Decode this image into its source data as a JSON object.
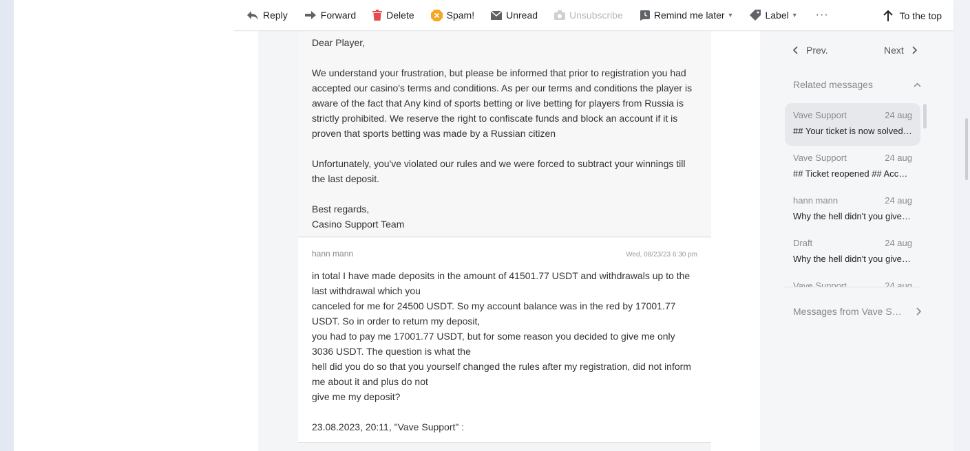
{
  "toolbar": {
    "reply": "Reply",
    "forward": "Forward",
    "delete": "Delete",
    "spam": "Spam!",
    "unread": "Unread",
    "unsubscribe": "Unsubscribe",
    "remind": "Remind me later",
    "label": "Label",
    "more": "···",
    "to_top": "To the top"
  },
  "messages": [
    {
      "lines": [
        "Dear Player,",
        "",
        "We understand your frustration, but please be informed that prior to registration you had accepted our casino's terms and conditions. As per our terms and conditions the player is aware of the fact that Any kind of sports betting or live betting for players from Russia is strictly prohibited. We reserve the right to confiscate funds and block an account if it is proven that sports betting was made by a Russian citizen",
        "",
        "Unfortunately, you've violated our rules and we were forced to subtract your winnings till the last deposit.",
        "",
        "Best regards,",
        "Casino Support Team"
      ]
    },
    {
      "sender": "hann mann",
      "date": "Wed, 08/23/23 6:30 pm",
      "lines": [
        "in total I have made deposits in the amount of 41501.77 USDT and withdrawals up to the last withdrawal which you",
        "canceled for me for 24500 USDT. So my account balance was in the red by 17001.77 USDT. So in order to return my deposit,",
        "you had to pay me 17001.77 USDT, but for some reason you decided to give me only 3036 USDT. The question is what the",
        "hell did you do so that you yourself changed the rules after my registration, did not inform me about it and plus do not",
        "give me my deposit?",
        "",
        "23.08.2023, 20:11, \"Vave Support\" :"
      ]
    }
  ],
  "sidebar": {
    "prev": "Prev.",
    "next": "Next",
    "related_title": "Related messages",
    "related": [
      {
        "from": "Vave Support",
        "date": "24 aug",
        "subject": "## Your ticket is now solved ##"
      },
      {
        "from": "Vave Support",
        "date": "24 aug",
        "subject": "## Ticket reopened ## Accepted"
      },
      {
        "from": "hann mann",
        "date": "24 aug",
        "subject": "Why the hell didn't you give me"
      },
      {
        "from": "Draft",
        "date": "24 aug",
        "subject": "Why the hell didn't you give me"
      },
      {
        "from": "Vave Support",
        "date": "24 aug",
        "subject": ""
      }
    ],
    "messages_from": "Messages from Vave Support"
  },
  "colors": {
    "delete_icon": "#e64a4a",
    "spam_icon": "#f5a623",
    "icon_gray": "#5f6368"
  }
}
